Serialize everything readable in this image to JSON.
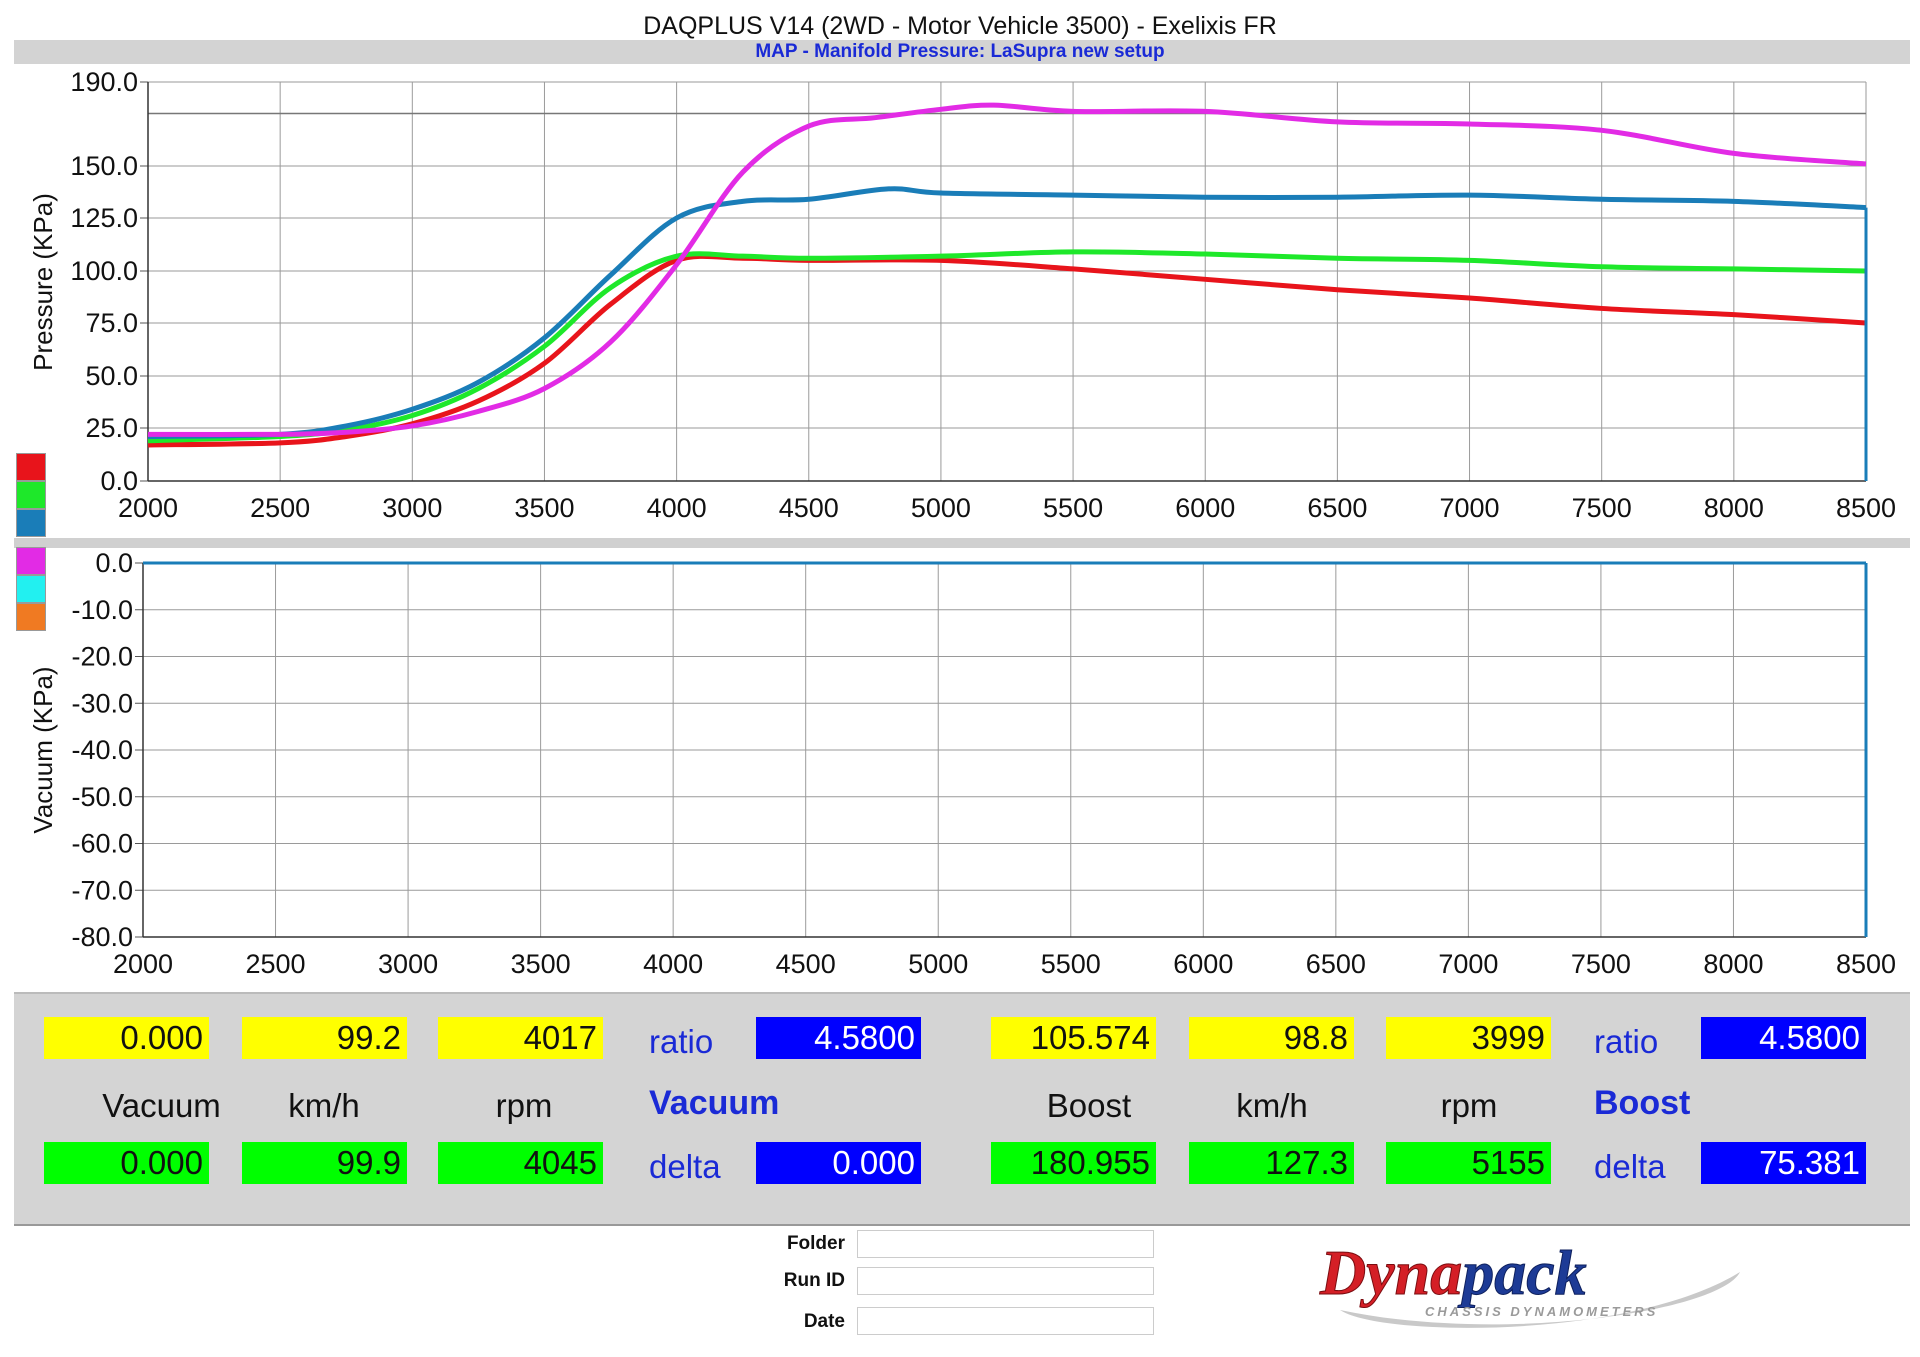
{
  "header": {
    "title": "DAQPLUS V14 (2WD - Motor Vehicle 3500) - Exelixis FR",
    "subtitle": "MAP - Manifold Pressure: LaSupra new setup"
  },
  "chart_data": [
    {
      "type": "line",
      "name_id": "pressure",
      "ylabel": "Pressure (KPa)",
      "xlim": [
        2000,
        8500
      ],
      "ylim": [
        0,
        190
      ],
      "x_ticks": [
        "2000",
        "2500",
        "3000",
        "3500",
        "4000",
        "4500",
        "5000",
        "5500",
        "6000",
        "6500",
        "7000",
        "7500",
        "8000",
        "8500"
      ],
      "y_ticks": [
        {
          "v": 190,
          "t": "190.0"
        },
        {
          "v": 150,
          "t": "150.0"
        },
        {
          "v": 125,
          "t": "125.0"
        },
        {
          "v": 100,
          "t": "100.0"
        },
        {
          "v": 75,
          "t": "75.0"
        },
        {
          "v": 50,
          "t": "50.0"
        },
        {
          "v": 25,
          "t": "25.0"
        },
        {
          "v": 0,
          "t": "0.0"
        }
      ],
      "reference_line": 175,
      "series": [
        {
          "color": "#e8141b",
          "x": [
            2000,
            2500,
            2750,
            3000,
            3250,
            3500,
            3750,
            4000,
            4250,
            4500,
            5000,
            5500,
            6000,
            6500,
            7000,
            7500,
            8000,
            8500
          ],
          "y": [
            17,
            18,
            21,
            27,
            38,
            56,
            84,
            105,
            106,
            105,
            105,
            101,
            96,
            91,
            87,
            82,
            79,
            75
          ]
        },
        {
          "color": "#1ee82a",
          "x": [
            2000,
            2500,
            2750,
            3000,
            3250,
            3500,
            3750,
            4000,
            4250,
            4500,
            5000,
            5500,
            6000,
            6500,
            7000,
            7500,
            8000,
            8500
          ],
          "y": [
            19,
            21,
            24,
            31,
            44,
            64,
            92,
            107,
            107,
            106,
            107,
            109,
            108,
            106,
            105,
            102,
            101,
            100
          ]
        },
        {
          "color": "#1a7db8",
          "x": [
            2000,
            2500,
            2750,
            3000,
            3250,
            3500,
            3750,
            4000,
            4250,
            4500,
            4800,
            5000,
            5500,
            6000,
            6500,
            7000,
            7500,
            8000,
            8500
          ],
          "y": [
            21,
            22,
            26,
            34,
            47,
            68,
            98,
            125,
            133,
            134,
            139,
            137,
            136,
            135,
            135,
            136,
            134,
            133,
            130
          ]
        },
        {
          "color": "#e22be5",
          "x": [
            2000,
            2500,
            2750,
            3000,
            3250,
            3500,
            3750,
            4000,
            4250,
            4500,
            4750,
            5000,
            5200,
            5500,
            6000,
            6500,
            7000,
            7500,
            8000,
            8500
          ],
          "y": [
            22,
            22,
            23,
            26,
            33,
            44,
            66,
            103,
            147,
            169,
            173,
            177,
            179,
            176,
            176,
            171,
            170,
            167,
            156,
            151
          ]
        }
      ]
    },
    {
      "type": "line",
      "name_id": "vacuum",
      "ylabel": "Vacuum (KPa)",
      "xlim": [
        2000,
        8500
      ],
      "ylim": [
        -80,
        0
      ],
      "x_ticks": [
        "2000",
        "2500",
        "3000",
        "3500",
        "4000",
        "4500",
        "5000",
        "5500",
        "6000",
        "6500",
        "7000",
        "7500",
        "8000",
        "8500"
      ],
      "y_ticks": [
        {
          "v": 0,
          "t": "0.0"
        },
        {
          "v": -10,
          "t": "-10.0"
        },
        {
          "v": -20,
          "t": "-20.0"
        },
        {
          "v": -30,
          "t": "-30.0"
        },
        {
          "v": -40,
          "t": "-40.0"
        },
        {
          "v": -50,
          "t": "-50.0"
        },
        {
          "v": -60,
          "t": "-60.0"
        },
        {
          "v": -70,
          "t": "-70.0"
        },
        {
          "v": -80,
          "t": "-80.0"
        }
      ],
      "series": [
        {
          "color": "#1a7db8",
          "x": [
            2000,
            8500
          ],
          "y": [
            0,
            0
          ]
        }
      ]
    }
  ],
  "legend_swatches": [
    "#e8141b",
    "#1ee82a",
    "#1a7db8",
    "#e22be5",
    "#22f0f0",
    "#f07a22"
  ],
  "readout": {
    "vacuum": {
      "cur_value": "0.000",
      "cur_speed": "99.2",
      "cur_rpm": "4017",
      "ratio_label": "ratio",
      "ratio": "4.5800",
      "label_main": "Vacuum",
      "label_speed": "km/h",
      "label_rpm": "rpm",
      "section": "Vacuum",
      "max_value": "0.000",
      "max_speed": "99.9",
      "max_rpm": "4045",
      "delta_label": "delta",
      "delta": "0.000"
    },
    "boost": {
      "cur_value": "105.574",
      "cur_speed": "98.8",
      "cur_rpm": "3999",
      "ratio_label": "ratio",
      "ratio": "4.5800",
      "label_main": "Boost",
      "label_speed": "km/h",
      "label_rpm": "rpm",
      "section": "Boost",
      "max_value": "180.955",
      "max_speed": "127.3",
      "max_rpm": "5155",
      "delta_label": "delta",
      "delta": "75.381"
    }
  },
  "form": {
    "folder": "Folder",
    "run_id": "Run ID",
    "date": "Date"
  },
  "logo": {
    "brand": "Dynapack",
    "tagline": "CHASSIS DYNAMOMETERS"
  }
}
